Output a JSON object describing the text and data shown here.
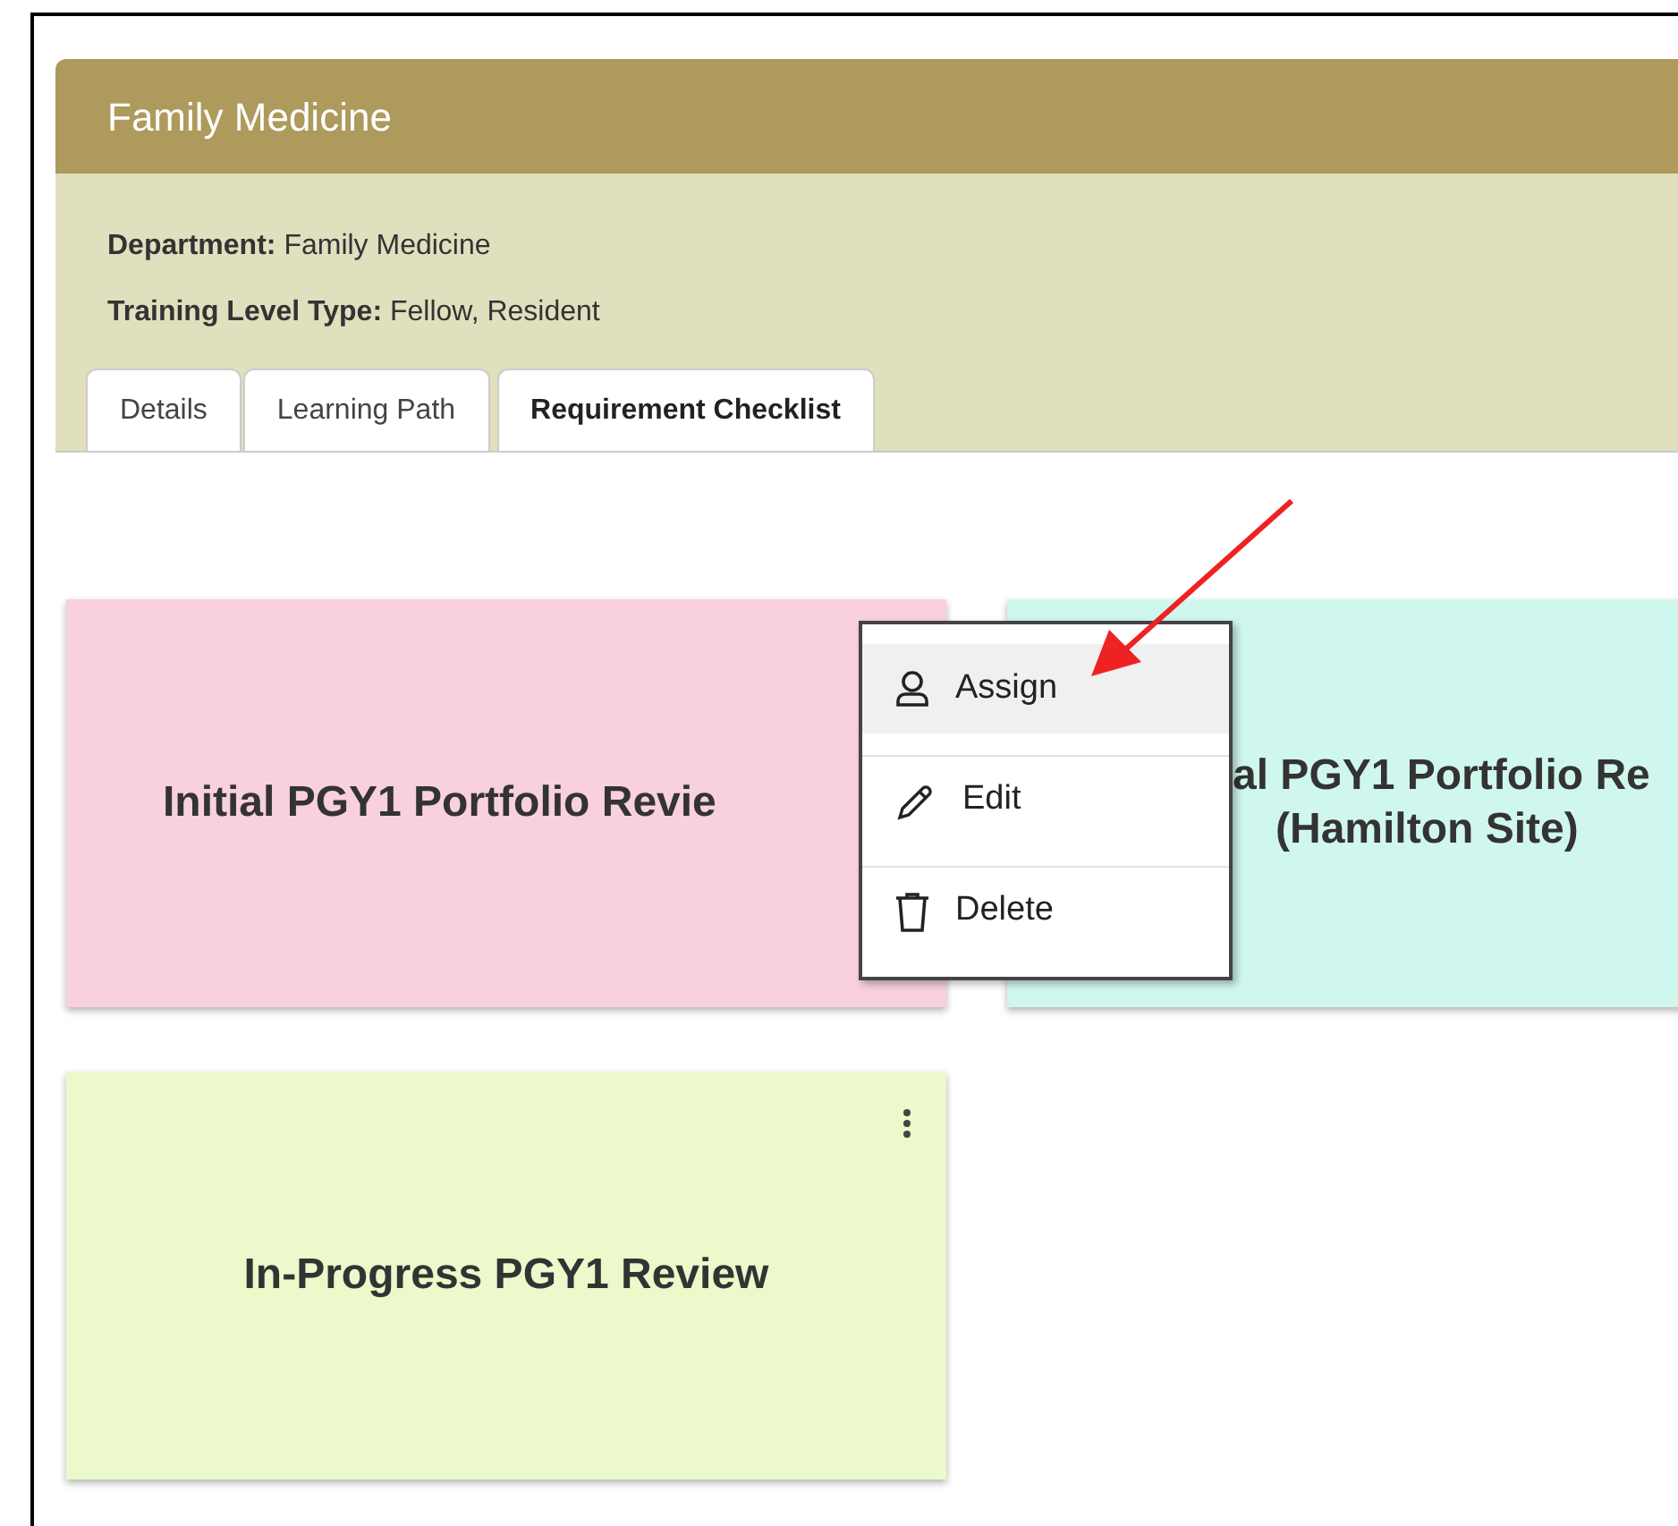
{
  "header": {
    "title": "Family Medicine"
  },
  "details": [
    {
      "label": "Department:",
      "value": "Family Medicine"
    },
    {
      "label": "Training Level Type:",
      "value": "Fellow, Resident"
    }
  ],
  "tabs": [
    {
      "label": "Details",
      "selected": false
    },
    {
      "label": "Learning Path",
      "selected": false
    },
    {
      "label": "Requirement Checklist",
      "selected": true
    }
  ],
  "cards": [
    {
      "title_lines": [
        "Initial PGY1 Portfolio Revie"
      ],
      "color": "#f8d0e0",
      "menu_button": false
    },
    {
      "title_lines": [
        "al PGY1 Portfolio Re",
        "(Hamilton Site)"
      ],
      "color": "#d0f7ee",
      "menu_button": false
    },
    {
      "title_lines": [
        "In-Progress PGY1 Review"
      ],
      "color": "#ebf9cb",
      "menu_button": true
    }
  ],
  "context_menu": {
    "items": [
      {
        "label": "Assign",
        "selected": true
      },
      {
        "label": "Edit",
        "selected": false
      },
      {
        "label": "Delete",
        "selected": false
      }
    ]
  }
}
